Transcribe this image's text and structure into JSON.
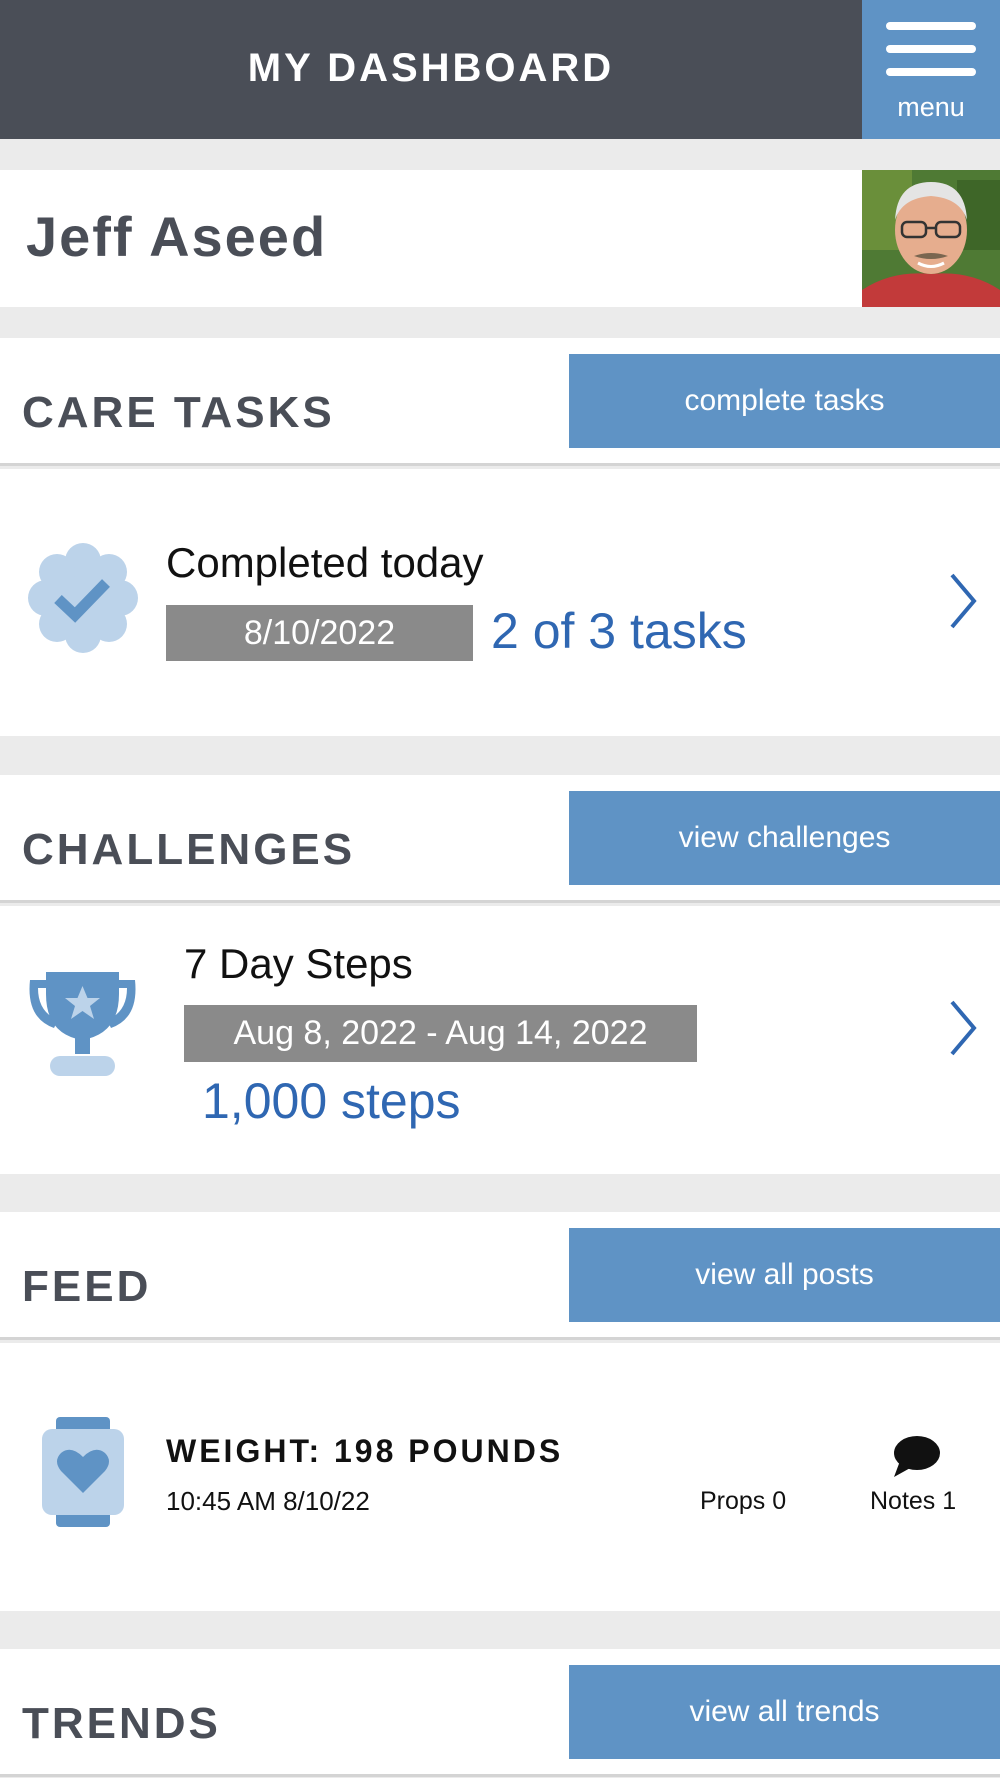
{
  "header": {
    "title": "MY DASHBOARD",
    "menu_label": "menu"
  },
  "profile": {
    "name": "Jeff Aseed",
    "avatar_icon": "user-photo"
  },
  "care_tasks": {
    "title": "CARE TASKS",
    "button_label": "complete tasks",
    "card": {
      "icon": "badge-check-icon",
      "heading": "Completed today",
      "date": "8/10/2022",
      "summary": "2 of 3 tasks"
    }
  },
  "challenges": {
    "title": "CHALLENGES",
    "button_label": "view challenges",
    "card": {
      "icon": "trophy-icon",
      "heading": "7 Day Steps",
      "date_range": "Aug 8, 2022 - Aug 14, 2022",
      "goal": "1,000 steps"
    }
  },
  "feed": {
    "title": "FEED",
    "button_label": "view all posts",
    "post": {
      "icon": "smartwatch-heart-icon",
      "heading": "WEIGHT: 198 POUNDS",
      "timestamp": "10:45 AM 8/10/22",
      "props": "Props 0",
      "notes": "Notes 1"
    }
  },
  "trends": {
    "title": "TRENDS",
    "button_label": "view all trends"
  },
  "colors": {
    "header_bg": "#4a4e57",
    "accent": "#5f93c5",
    "link_blue": "#2f67b2",
    "badge_gray": "#8a8a8a",
    "page_bg": "#ebebeb"
  }
}
